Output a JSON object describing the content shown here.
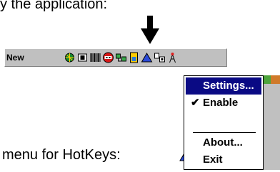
{
  "header_text": "y the application:",
  "taskbar": {
    "new_label": "New",
    "tray_icons": [
      "globe-icon",
      "phone-icon",
      "barcode-icon",
      "hotkeys-icon",
      "network-icon",
      "battery-icon",
      "triangle-icon",
      "connection-icon",
      "antenna-icon"
    ]
  },
  "menu_label": "menu for HotKeys:",
  "context_menu": {
    "items": [
      {
        "label": "Settings...",
        "selected": true,
        "checked": false
      },
      {
        "label": "Enable",
        "selected": false,
        "checked": true
      },
      {
        "label": "About...",
        "selected": false,
        "checked": false
      },
      {
        "label": "Exit",
        "selected": false,
        "checked": false
      }
    ],
    "check_glyph": "✔"
  },
  "colors": {
    "selection": "#0a0a84",
    "taskbar": "#c0c0c0"
  }
}
